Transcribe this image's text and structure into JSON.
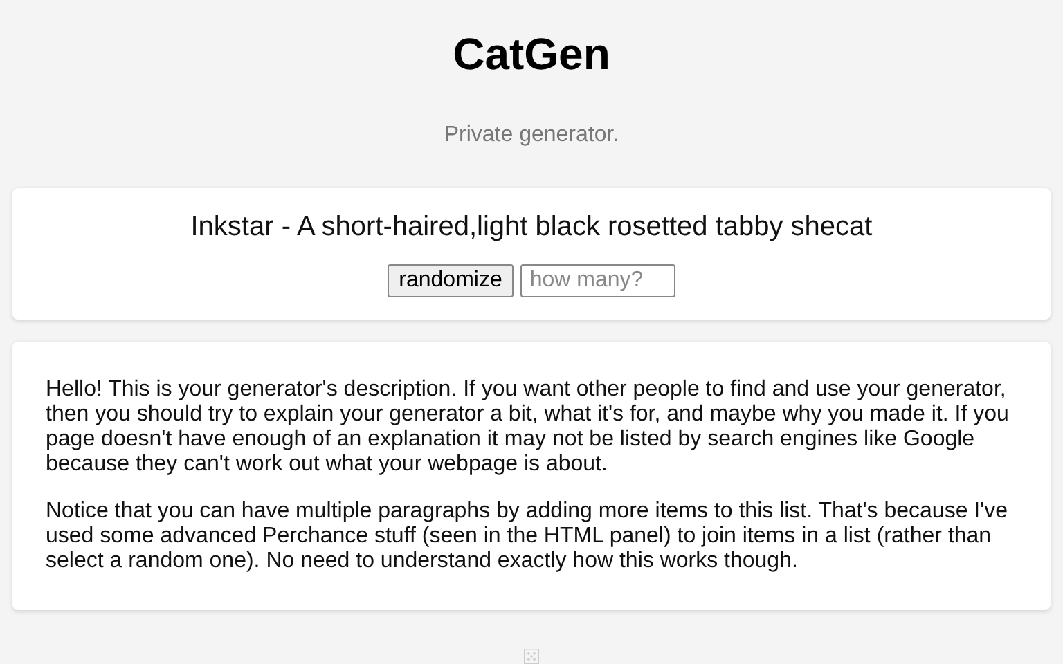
{
  "title": "CatGen",
  "subtitle": "Private generator.",
  "output": "Inkstar - A short-haired,light black rosetted tabby shecat",
  "button": "randomize",
  "count_field": {
    "placeholder": "how many?"
  },
  "paragraphs": [
    "Hello! This is your generator's description. If you want other people to find and use your generator, then you should try to explain your generator a bit, what it's for, and maybe why you made it. If you page doesn't have enough of an explanation it may not be listed by search engines like Google because they can't work out what your webpage is about.",
    "Notice that you can have multiple paragraphs by adding more items to this list. That's because I've used some advanced Perchance stuff (seen in the HTML panel) to join items in a list (rather than select a random one). No need to understand exactly how this works though."
  ]
}
